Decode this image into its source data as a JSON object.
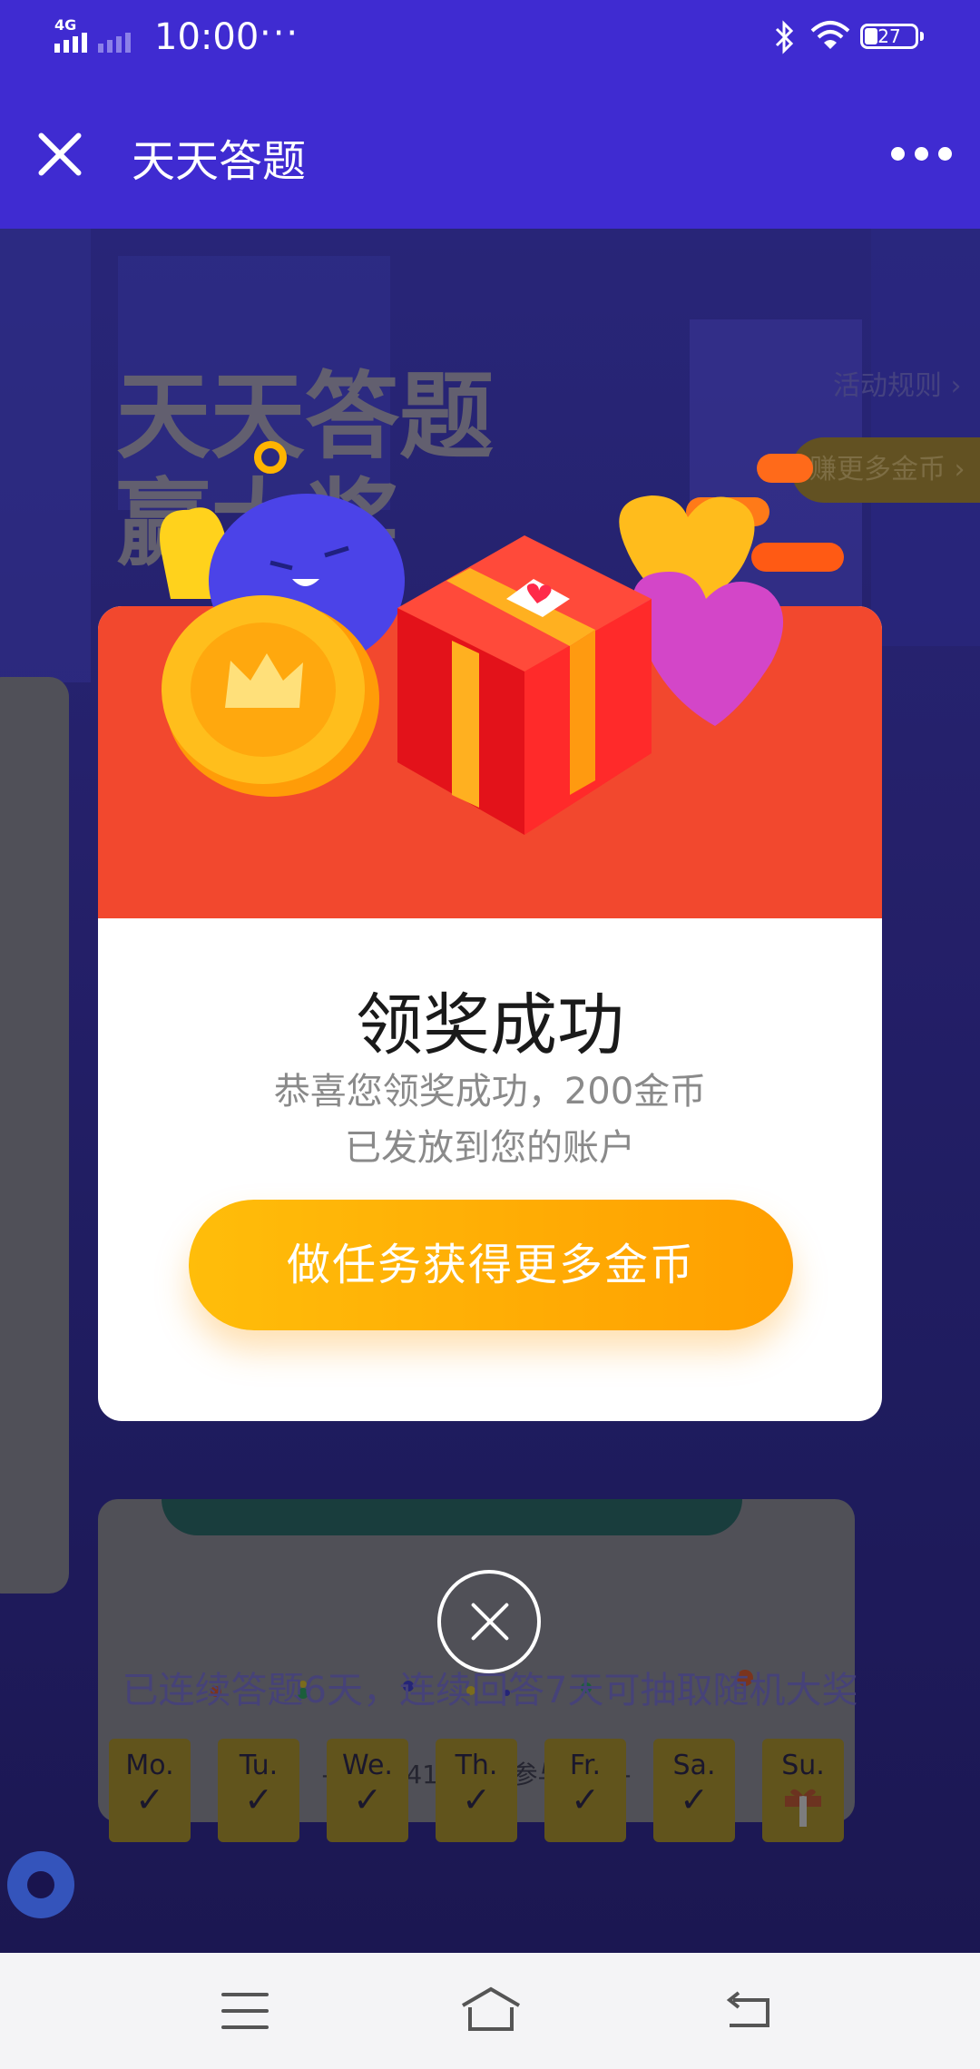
{
  "status_bar": {
    "network": "4G",
    "time": "10:00",
    "more_dots": "···",
    "battery": "27"
  },
  "app_bar": {
    "title": "天天答题"
  },
  "page": {
    "hero_title_line1": "天天答题",
    "hero_title_line2": "赢大奖",
    "rules_link": "活动规则",
    "earn_more": "赚更多金币",
    "participants": "- 已有141349人参与答题 -",
    "streak": "已连续答题6天，连续回答7天可抽取随机大奖",
    "days": [
      {
        "label": "Mo.",
        "done": true
      },
      {
        "label": "Tu.",
        "done": true
      },
      {
        "label": "We.",
        "done": true
      },
      {
        "label": "Th.",
        "done": true
      },
      {
        "label": "Fr.",
        "done": true
      },
      {
        "label": "Sa.",
        "done": true
      },
      {
        "label": "Su.",
        "done": false
      }
    ]
  },
  "modal": {
    "title": "领奖成功",
    "subtitle_line1": "恭喜您领奖成功，200金币",
    "subtitle_line2": "已发放到您的账户",
    "button_label": "做任务获得更多金币"
  },
  "icons": {
    "close": "close-icon",
    "more": "more-icon",
    "gift": "gift-icon",
    "coin": "coin-icon",
    "heart": "heart-icon"
  },
  "colors": {
    "app_bar": "#3f2bd1",
    "modal_header": "#f2482e",
    "button_start": "#ffbd0a",
    "button_end": "#ff9f00"
  }
}
